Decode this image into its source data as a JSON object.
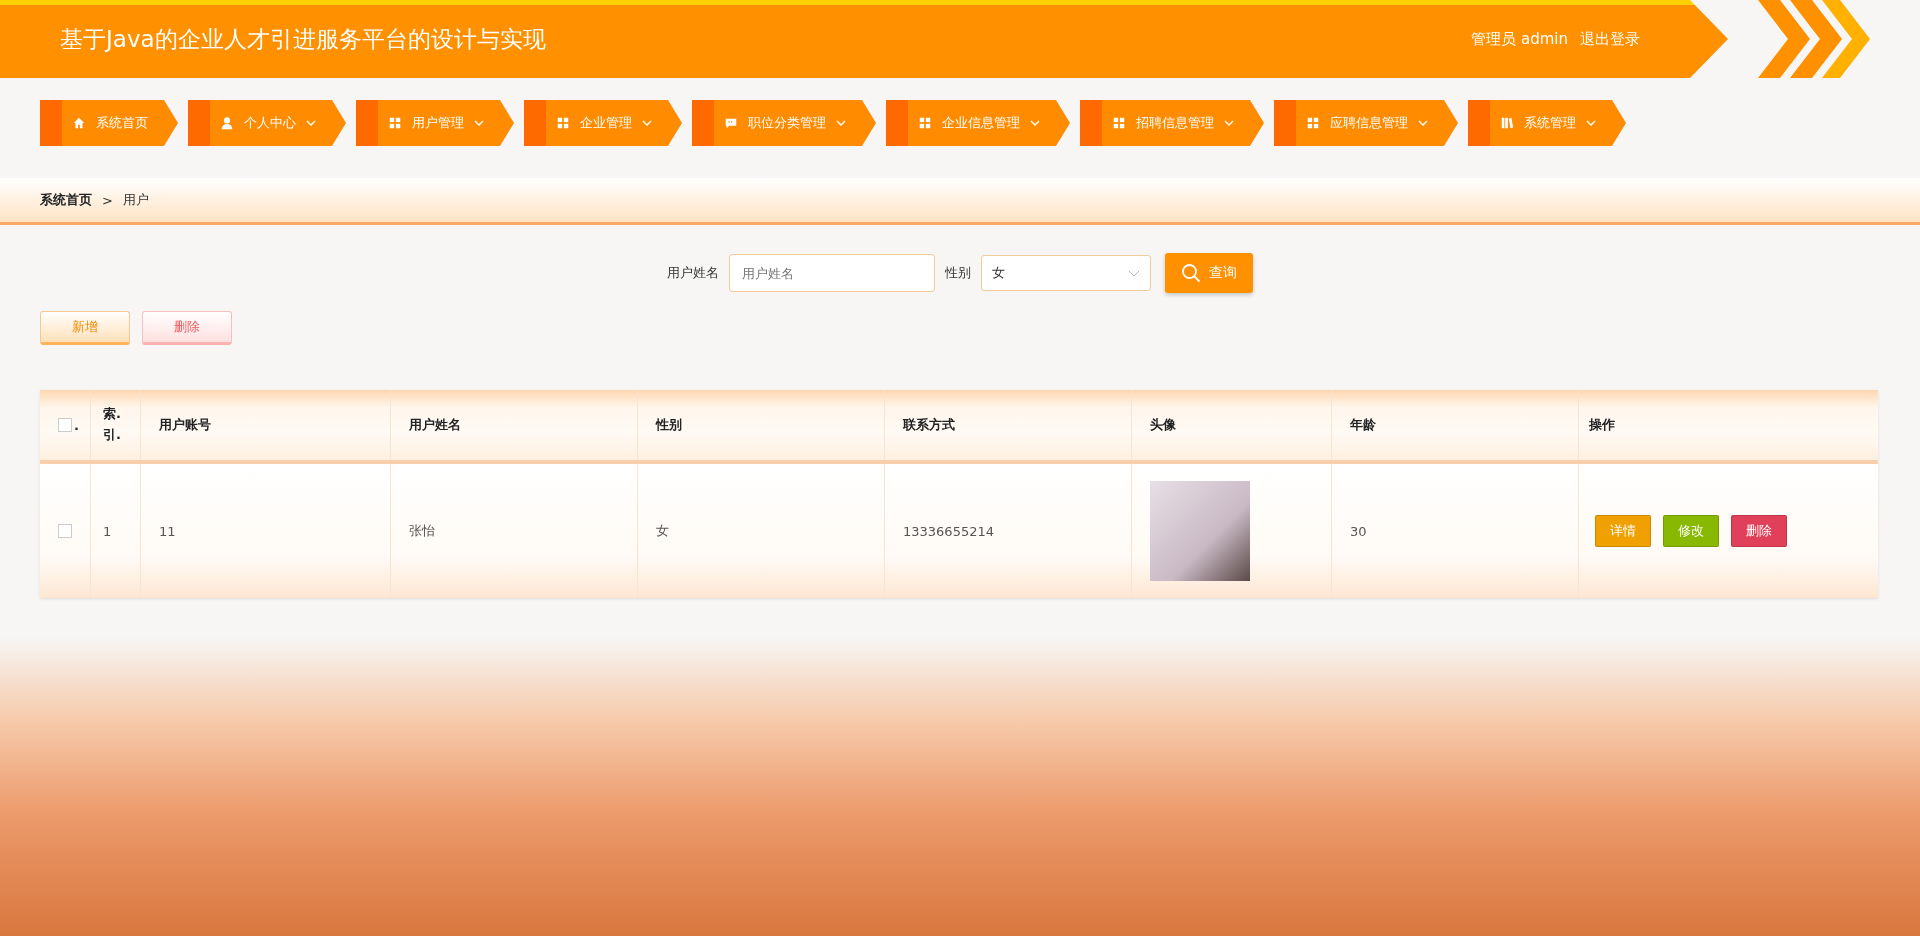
{
  "header": {
    "title": "基于Java的企业人才引进服务平台的设计与实现",
    "role": "管理员 admin",
    "logout": "退出登录"
  },
  "nav": [
    {
      "label": "系统首页",
      "kind": "home",
      "dropdown": false
    },
    {
      "label": "个人中心",
      "kind": "user",
      "dropdown": true
    },
    {
      "label": "用户管理",
      "kind": "grid",
      "dropdown": true
    },
    {
      "label": "企业管理",
      "kind": "grid",
      "dropdown": true
    },
    {
      "label": "职位分类管理",
      "kind": "chat",
      "dropdown": true
    },
    {
      "label": "企业信息管理",
      "kind": "grid",
      "dropdown": true
    },
    {
      "label": "招聘信息管理",
      "kind": "grid",
      "dropdown": true
    },
    {
      "label": "应聘信息管理",
      "kind": "grid",
      "dropdown": true
    },
    {
      "label": "系统管理",
      "kind": "book",
      "dropdown": true
    }
  ],
  "breadcrumb": {
    "home": "系统首页",
    "separator": ">",
    "current": "用户"
  },
  "search": {
    "name_label": "用户姓名",
    "name_placeholder": "用户姓名",
    "gender_label": "性别",
    "gender_value": "女",
    "button": "查询"
  },
  "actions": {
    "add": "新增",
    "delete": "删除"
  },
  "table": {
    "select_all_checked": false,
    "select_all_suffix": ".",
    "columns": [
      "索.引.",
      "用户账号",
      "用户姓名",
      "性别",
      "联系方式",
      "头像",
      "年龄",
      "操作"
    ],
    "rows": [
      {
        "checked": false,
        "index": "1",
        "account": "11",
        "name": "张怡",
        "gender": "女",
        "phone": "13336655214",
        "age": "30",
        "buttons": [
          "详情",
          "修改",
          "删除"
        ]
      }
    ]
  }
}
